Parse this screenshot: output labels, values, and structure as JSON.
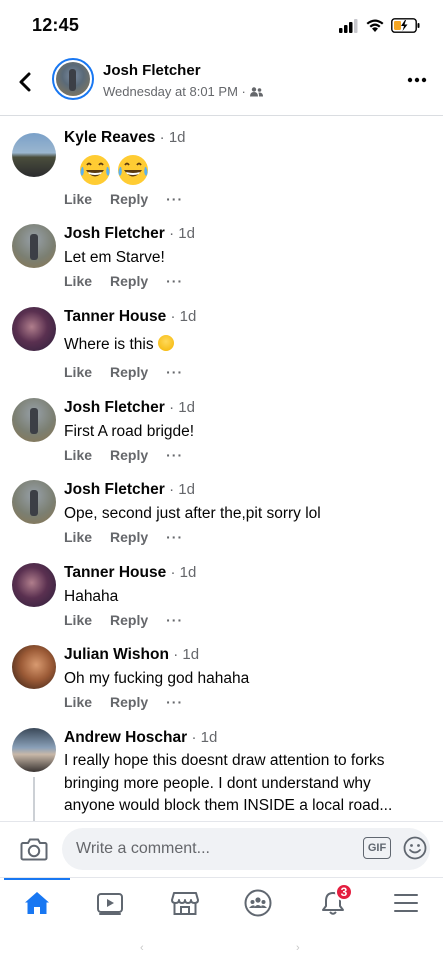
{
  "status": {
    "time": "12:45"
  },
  "header": {
    "name": "Josh Fletcher",
    "subtitle": "Wednesday at 8:01 PM · ",
    "back_icon": "chevron-left-icon",
    "more_icon": "more-dots-icon"
  },
  "comments": [
    {
      "author": "Kyle Reaves",
      "time": "· 1d",
      "text": "",
      "emoji": "laughing-tears-emoji x2",
      "like": "Like",
      "reply": "Reply",
      "more": "···"
    },
    {
      "author": "Josh Fletcher",
      "time": "· 1d",
      "text": "Let em Starve!",
      "like": "Like",
      "reply": "Reply",
      "more": "···"
    },
    {
      "author": "Tanner House",
      "time": "· 1d",
      "text": "Where is this ",
      "like": "Like",
      "reply": "Reply",
      "more": "···"
    },
    {
      "author": "Josh Fletcher",
      "time": "· 1d",
      "text": "First A road brigde!",
      "like": "Like",
      "reply": "Reply",
      "more": "···"
    },
    {
      "author": "Josh Fletcher",
      "time": "· 1d",
      "text": "Ope, second just after the,pit sorry lol",
      "like": "Like",
      "reply": "Reply",
      "more": "···"
    },
    {
      "author": "Tanner House",
      "time": "· 1d",
      "text": "Hahaha",
      "like": "Like",
      "reply": "Reply",
      "more": "···"
    },
    {
      "author": "Julian Wishon",
      "time": "· 1d",
      "text": "Oh my fucking god hahaha",
      "like": "Like",
      "reply": "Reply",
      "more": "···"
    },
    {
      "author": "Andrew Hoschar",
      "time": "· 1d",
      "text": "I really hope this doesnt draw attention to forks bringing more people. I dont understand why anyone would block them INSIDE a local road...",
      "like": "Like",
      "reply": "Reply",
      "more": "···"
    }
  ],
  "composer": {
    "placeholder": "Write a comment...",
    "gif_label": "GIF"
  },
  "tabbar": {
    "notifications_badge": "3"
  },
  "colors": {
    "accent": "#1877f2",
    "badge": "#e41e3f",
    "secondary_text": "#65676b"
  },
  "nav": {
    "back": "‹",
    "forward": "›"
  }
}
